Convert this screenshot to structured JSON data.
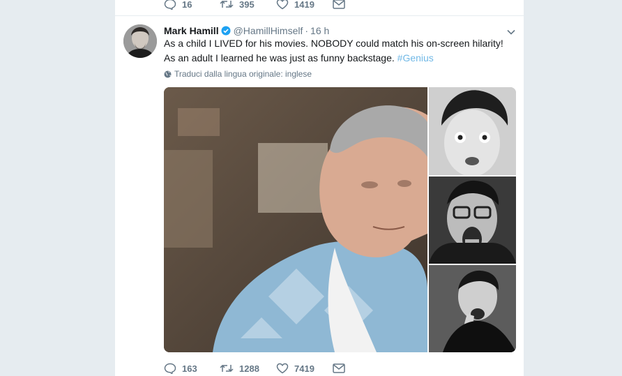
{
  "prev_tweet": {
    "reply_count": "16",
    "retweet_count": "395",
    "like_count": "1419"
  },
  "tweet": {
    "author_name": "Mark Hamill",
    "handle": "@HamillHimself",
    "separator": "·",
    "time": "16 h",
    "text_line1": "As a child I LIVED for his movies. NOBODY could match his on-screen hilarity!",
    "text_line2": "As an adult I learned he was just as funny backstage.",
    "hashtag": "#Genius",
    "translate_label": "Traduci dalla lingua originale: inglese",
    "reply_count": "163",
    "retweet_count": "1288",
    "like_count": "7419"
  },
  "colors": {
    "page_background": "#e6ecf0",
    "link": "#70b8e6",
    "secondary_text": "#657786",
    "verified": "#1da1f2"
  },
  "icons": {
    "reply": "reply-icon",
    "retweet": "retweet-icon",
    "like": "heart-icon",
    "message": "envelope-icon",
    "verified": "verified-badge-icon",
    "caret": "chevron-down-icon",
    "globe": "globe-icon"
  }
}
